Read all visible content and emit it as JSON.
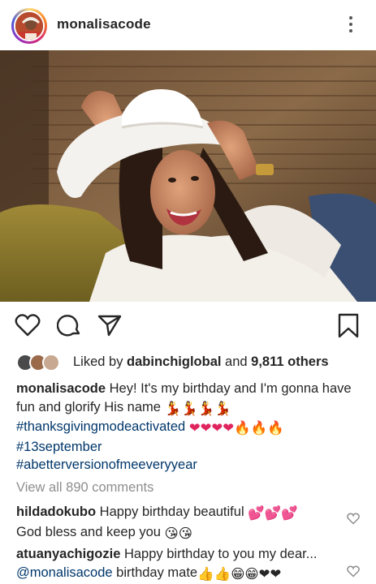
{
  "post": {
    "username": "monalisacode"
  },
  "actions": {
    "like_icon": "heart-outline-icon",
    "comment_icon": "comment-bubble-icon",
    "share_icon": "send-paper-plane-icon",
    "save_icon": "bookmark-icon"
  },
  "likes": {
    "prefix": "Liked by ",
    "user": "dabinchiglobal",
    "middle": " and ",
    "others": "9,811 others"
  },
  "caption": {
    "username": "monalisacode",
    "text": " Hey! It's my birthday and I'm gonna have fun and glorify His name ",
    "dancers": "💃💃💃💃",
    "hashtag1": "#thanksgivingmodeactivated",
    "hearts_fire": "❤❤❤❤🔥🔥🔥",
    "hashtag2": "#13september",
    "hashtag3": "#abetterversionofmeeveryyear"
  },
  "view_all": "View all 890 comments",
  "comments": [
    {
      "username": "hildadokubo",
      "text": " Happy birthday beautiful ",
      "emoji1": "💕💕💕",
      "line2": "God bless and keep you ",
      "emoji2": "😘😘"
    },
    {
      "username": "atuanyachigozie",
      "text": " Happy birthday to you my dear...",
      "mention": "@monalisacode",
      "line2": " birthday mate",
      "emoji2": "👍👍😁😁❤❤"
    }
  ],
  "colors": {
    "text": "#262626",
    "link": "#00376b",
    "muted": "#8e8e8e"
  }
}
